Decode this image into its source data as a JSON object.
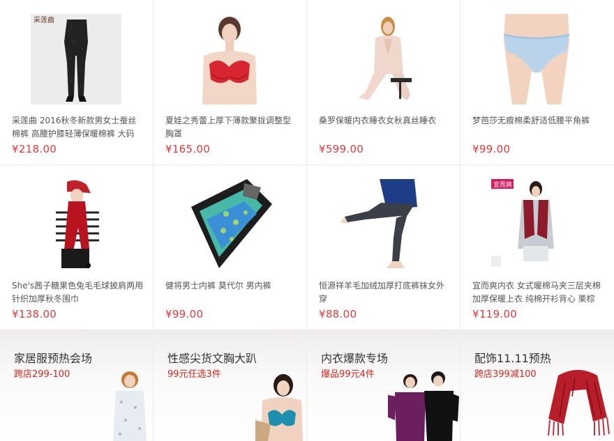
{
  "products": [
    {
      "title": "采莲曲 2016秋冬新款男女士蚕丝棉裤 高腰护膝轻薄保暖棉裤 大码",
      "price": "¥218.00",
      "brand_tag": "采莲曲",
      "icon": "leggings-image"
    },
    {
      "title": "夏娃之秀蕾上厚下薄款聚拢调整型胸罩",
      "price": "¥165.00",
      "icon": "red-bra-image"
    },
    {
      "title": "桑罗保暖内衣睡衣女秋真丝睡衣",
      "price": "¥599.00",
      "icon": "silk-pajamas-image"
    },
    {
      "title": "梦芭莎无痕棉柔舒适低腰平角裤",
      "price": "¥99.00",
      "icon": "blue-briefs-image"
    },
    {
      "title": "She's茜子糖果色兔毛毛球披肩两用针织加厚秋冬围巾",
      "price": "¥138.00",
      "icon": "red-scarf-image"
    },
    {
      "title": "健将男士内裤 莫代尔 男内裤",
      "price": "¥99.00",
      "icon": "boxer-box-image"
    },
    {
      "title": "恒源祥羊毛加绒加厚打底裤袜女外穿",
      "price": "¥88.00",
      "icon": "tights-image"
    },
    {
      "title": "宜而爽内衣 女式暖棉马夹三层夹棉加厚保暖上衣 纯棉开衫背心 栗棕",
      "price": "¥119.00",
      "brand_tag": "宜而爽",
      "icon": "vest-image"
    }
  ],
  "promos": [
    {
      "title": "家居服预热会场",
      "subtitle": "跨店299-100",
      "icon": "loungewear-image"
    },
    {
      "title": "性感尖货文胸大趴",
      "subtitle": "99元任选3件",
      "icon": "bra-model-image"
    },
    {
      "title": "内衣爆款专场",
      "subtitle": "爆品99元4件",
      "icon": "thermal-couple-image"
    },
    {
      "title": "配饰11.11预热",
      "subtitle": "跨店399减100",
      "icon": "red-scarf-image"
    }
  ],
  "colors": {
    "price": "#e4393c",
    "promo_sub": "#d2281e",
    "border": "#ececec"
  }
}
